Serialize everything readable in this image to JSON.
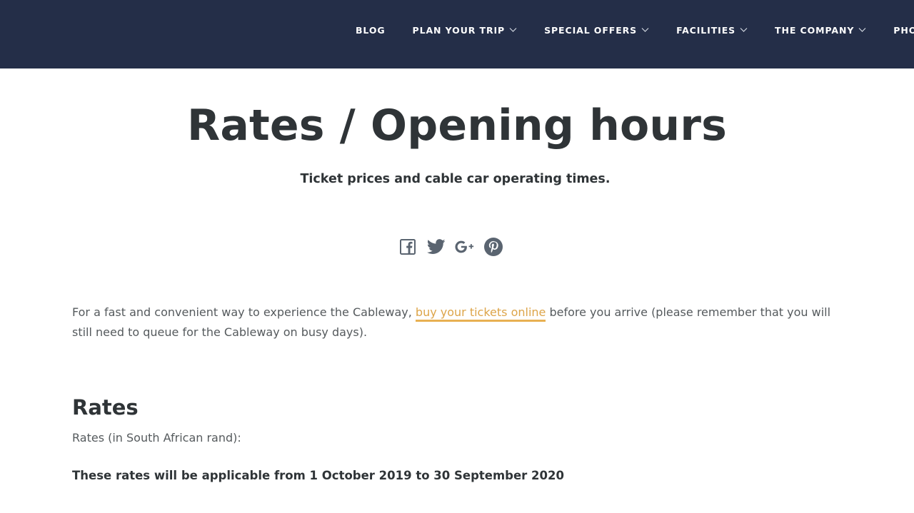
{
  "nav": {
    "items": [
      {
        "label": "BLOG",
        "has_dropdown": false
      },
      {
        "label": "PLAN YOUR TRIP",
        "has_dropdown": true
      },
      {
        "label": "SPECIAL OFFERS",
        "has_dropdown": true
      },
      {
        "label": "FACILITIES",
        "has_dropdown": true
      },
      {
        "label": "THE COMPANY",
        "has_dropdown": true
      },
      {
        "label": "PHOTOGR",
        "has_dropdown": false
      }
    ]
  },
  "header": {
    "title": "Rates / Opening hours",
    "subtitle": "Ticket prices and cable car operating times."
  },
  "share": {
    "icons": [
      "facebook-icon",
      "twitter-icon",
      "google-plus-icon",
      "pinterest-icon"
    ]
  },
  "intro": {
    "text_before": "For a fast and convenient way to experience the Cableway, ",
    "link_text": "buy your tickets online",
    "text_after": " before you arrive (please remember that you will still need to queue for the Cableway on busy days)."
  },
  "rates": {
    "heading": "Rates",
    "currency_note": "Rates (in South African rand):",
    "period": "These rates will be applicable from 1 October 2019 to 30 September 2020"
  },
  "colors": {
    "nav_background": "#242e48",
    "title_text": "#2f3437",
    "link_accent": "#dda54a",
    "icon_color": "#5a6470"
  }
}
